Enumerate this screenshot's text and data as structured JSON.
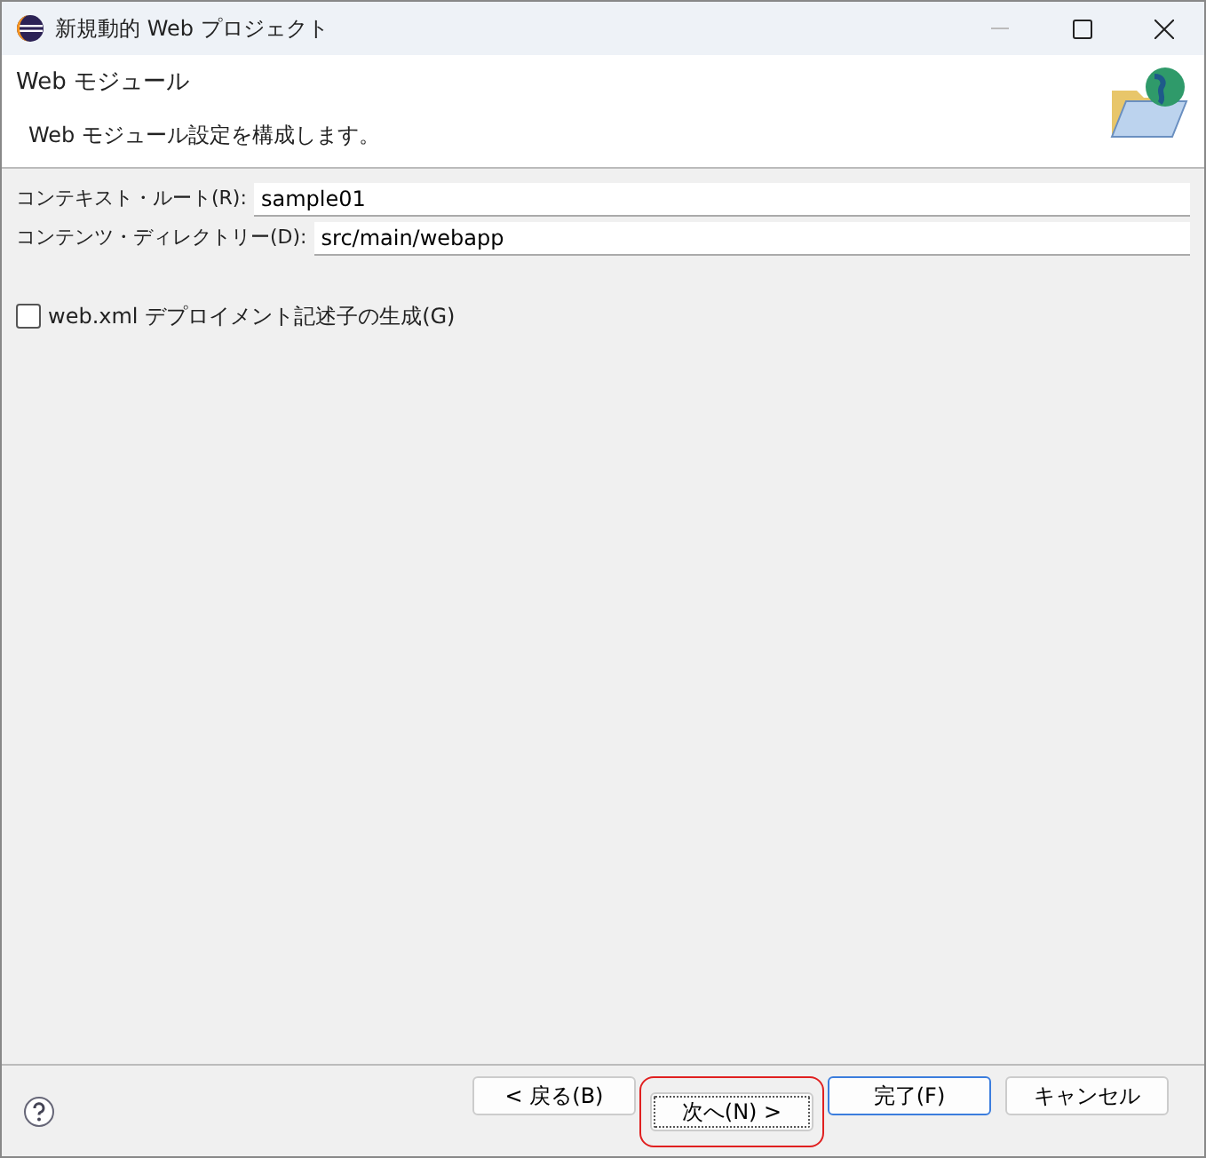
{
  "window": {
    "title": "新規動的 Web プロジェクト"
  },
  "header": {
    "title": "Web モジュール",
    "description": "Web モジュール設定を構成します。"
  },
  "fields": [
    {
      "label": "コンテキスト・ルート(R):",
      "value": "sample01"
    },
    {
      "label": "コンテンツ・ディレクトリー(D):",
      "value": "src/main/webapp"
    }
  ],
  "checkbox": {
    "label": "web.xml デプロイメント記述子の生成(G)",
    "checked": false
  },
  "buttons": [
    {
      "label": "< 戻る(B)",
      "default": false,
      "focused": false,
      "highlighted": false
    },
    {
      "label": "次へ(N) >",
      "default": false,
      "focused": true,
      "highlighted": true
    },
    {
      "label": "完了(F)",
      "default": true,
      "focused": false,
      "highlighted": false
    },
    {
      "label": "キャンセル",
      "default": false,
      "focused": false,
      "highlighted": false
    }
  ]
}
